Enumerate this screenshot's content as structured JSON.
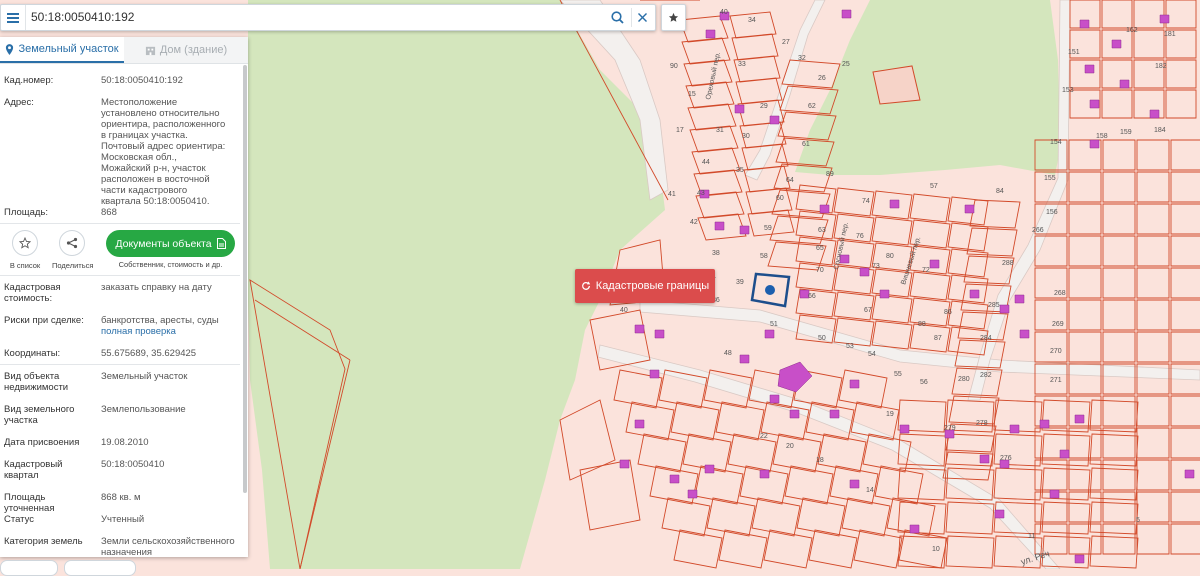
{
  "search": {
    "value": "50:18:0050410:192"
  },
  "tabs": {
    "land": "Земельный участок",
    "building": "Дом (здание)"
  },
  "fields": {
    "cad_number_label": "Кад.номер:",
    "cad_number_value": "50:18:0050410:192",
    "address_label": "Адрес:",
    "address_value": "Местоположение установлено относительно ориентира, расположенного в границах участка. Почтовый адрес ориентира: Московская обл., Можайский р-н, участок расположен в восточной части кадастрового квартала 50:18:0050410.",
    "area_label": "Площадь:",
    "area_value": "868",
    "cad_cost_label": "Кадастровая стоимость:",
    "cad_cost_link": "заказать справку на дату",
    "risks_label": "Риски при сделке:",
    "risks_value": "банкротства, аресты, суды",
    "risks_link": "полная проверка",
    "coords_label": "Координаты:",
    "coords_value": "55.675689, 35.629425",
    "object_type_label": "Вид объекта недвижимости",
    "object_type_value": "Земельный участок",
    "land_type_label": "Вид земельного участка",
    "land_type_value": "Землепользование",
    "assign_date_label": "Дата присвоения",
    "assign_date_value": "19.08.2010",
    "quarter_label": "Кадастровый квартал",
    "quarter_value": "50:18:0050410",
    "area_precise_label": "Площадь уточненная",
    "area_precise_value": "868 кв. м",
    "status_label": "Статус",
    "status_value": "Учтенный",
    "category_label": "Категория земель",
    "category_value": "Земли сельскохозяйственного назначения"
  },
  "actions": {
    "add_list": "В список",
    "share": "Поделиться",
    "docs_button": "Документы объекта",
    "docs_sub": "Собственник, стоимость и др."
  },
  "map": {
    "cad_boundaries_button": "Кадастровые границы",
    "street_label": "ул. Реч",
    "lane_labels": [
      "Ореховый пер.",
      "Сосновый пер.",
      "Вишневый пер."
    ],
    "plot_numbers": [
      {
        "n": "40"
      },
      {
        "n": "34"
      },
      {
        "n": "27"
      },
      {
        "n": "33"
      },
      {
        "n": "25"
      },
      {
        "n": "90"
      },
      {
        "n": "32"
      },
      {
        "n": "26"
      },
      {
        "n": "15"
      },
      {
        "n": "29"
      },
      {
        "n": "62"
      },
      {
        "n": "17"
      },
      {
        "n": "31"
      },
      {
        "n": "30"
      },
      {
        "n": "61"
      },
      {
        "n": "44"
      },
      {
        "n": "35"
      },
      {
        "n": "64"
      },
      {
        "n": "89"
      },
      {
        "n": "43"
      },
      {
        "n": "60"
      },
      {
        "n": "74"
      },
      {
        "n": "42"
      },
      {
        "n": "59"
      },
      {
        "n": "63"
      },
      {
        "n": "76"
      },
      {
        "n": "38"
      },
      {
        "n": "58"
      },
      {
        "n": "65"
      },
      {
        "n": "80"
      },
      {
        "n": "37"
      },
      {
        "n": "70"
      },
      {
        "n": "73"
      },
      {
        "n": "72"
      },
      {
        "n": "36"
      },
      {
        "n": "66"
      },
      {
        "n": "67"
      },
      {
        "n": "86"
      },
      {
        "n": "39"
      },
      {
        "n": "51"
      },
      {
        "n": "88"
      },
      {
        "n": "87"
      },
      {
        "n": "50"
      },
      {
        "n": "53"
      },
      {
        "n": "54"
      },
      {
        "n": "48"
      },
      {
        "n": "55"
      },
      {
        "n": "56"
      },
      {
        "n": "19"
      },
      {
        "n": "22"
      },
      {
        "n": "20"
      },
      {
        "n": "18"
      },
      {
        "n": "14"
      },
      {
        "n": "10"
      },
      {
        "n": "11"
      },
      {
        "n": "5"
      },
      {
        "n": "162"
      },
      {
        "n": "181"
      },
      {
        "n": "151"
      },
      {
        "n": "182"
      },
      {
        "n": "153"
      },
      {
        "n": "158"
      },
      {
        "n": "159"
      },
      {
        "n": "184"
      },
      {
        "n": "154"
      },
      {
        "n": "155"
      },
      {
        "n": "156"
      },
      {
        "n": "266"
      },
      {
        "n": "288"
      },
      {
        "n": "268"
      },
      {
        "n": "285"
      },
      {
        "n": "269"
      },
      {
        "n": "284"
      },
      {
        "n": "270"
      },
      {
        "n": "280"
      },
      {
        "n": "282"
      },
      {
        "n": "271"
      },
      {
        "n": "279"
      },
      {
        "n": "278"
      },
      {
        "n": "276"
      },
      {
        "n": "84"
      },
      {
        "n": "57"
      },
      {
        "n": "40"
      },
      {
        "n": "41"
      }
    ]
  },
  "colors": {
    "accent": "#2a6fa8",
    "docs_green": "#27a844",
    "cad_red": "#db4c4c",
    "plot_border": "#d24a2a",
    "building": "#c84fc8",
    "green_area": "#d4e6bd",
    "map_bg": "#fbe3dc"
  }
}
